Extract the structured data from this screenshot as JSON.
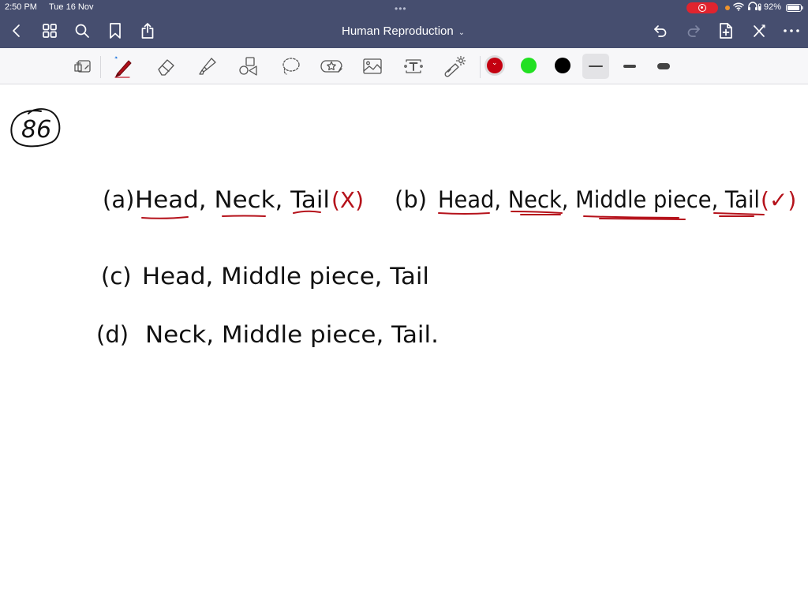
{
  "status_bar": {
    "time": "2:50 PM",
    "date": "Tue 16 Nov",
    "multitask_dots": "•••",
    "battery_percent": "92%",
    "battery_level": 0.92,
    "recording": true
  },
  "nav": {
    "title": "Human Reproduction",
    "title_chevron": "⌄",
    "left_icons": [
      "back-icon",
      "grid-icon",
      "search-icon",
      "bookmark-icon",
      "share-icon"
    ],
    "right_icons": [
      "undo-icon",
      "redo-icon",
      "add-page-icon",
      "close-pen-icon",
      "more-icon"
    ]
  },
  "toolbar": {
    "tools": [
      "page-layout-icon",
      "pen-icon",
      "eraser-icon",
      "highlighter-icon",
      "shapes-icon",
      "lasso-icon",
      "sticker-icon",
      "image-icon",
      "text-icon",
      "laser-pointer-icon"
    ],
    "active_tool": "pen",
    "colors": [
      {
        "name": "red",
        "hex": "#c40010",
        "selected": true
      },
      {
        "name": "green",
        "hex": "#22e022",
        "selected": false
      },
      {
        "name": "black",
        "hex": "#000000",
        "selected": false
      }
    ],
    "thickness_options": [
      "thin",
      "medium",
      "thick"
    ],
    "selected_thickness": "thin"
  },
  "note": {
    "question_number": "86",
    "options": [
      {
        "label": "(a)",
        "text": "Head, Neck, Tail",
        "mark": "(X)",
        "mark_meaning": "incorrect"
      },
      {
        "label": "(b)",
        "text": "Head, Neck, Middle piece, Tail",
        "mark": "(✓)",
        "mark_meaning": "correct"
      },
      {
        "label": "(c)",
        "text": "Head, Middle piece, Tail",
        "mark": ""
      },
      {
        "label": "(d)",
        "text": "Neck, Middle piece, Tail.",
        "mark": ""
      }
    ],
    "ink_color": "#111111",
    "annotation_color": "#b5121b"
  }
}
